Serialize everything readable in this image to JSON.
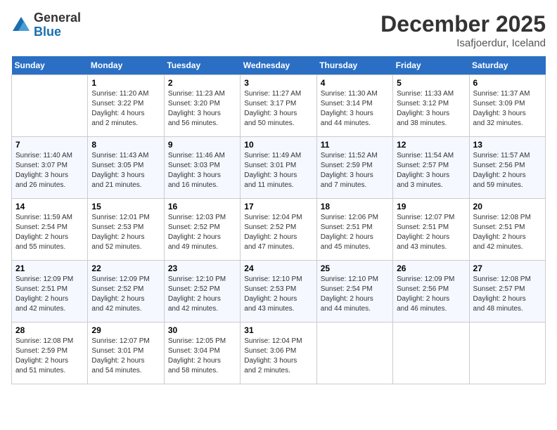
{
  "logo": {
    "general": "General",
    "blue": "Blue"
  },
  "title": "December 2025",
  "subtitle": "Isafjoerdur, Iceland",
  "days_header": [
    "Sunday",
    "Monday",
    "Tuesday",
    "Wednesday",
    "Thursday",
    "Friday",
    "Saturday"
  ],
  "weeks": [
    [
      {
        "day": "",
        "info": ""
      },
      {
        "day": "1",
        "info": "Sunrise: 11:20 AM\nSunset: 3:22 PM\nDaylight: 4 hours\nand 2 minutes."
      },
      {
        "day": "2",
        "info": "Sunrise: 11:23 AM\nSunset: 3:20 PM\nDaylight: 3 hours\nand 56 minutes."
      },
      {
        "day": "3",
        "info": "Sunrise: 11:27 AM\nSunset: 3:17 PM\nDaylight: 3 hours\nand 50 minutes."
      },
      {
        "day": "4",
        "info": "Sunrise: 11:30 AM\nSunset: 3:14 PM\nDaylight: 3 hours\nand 44 minutes."
      },
      {
        "day": "5",
        "info": "Sunrise: 11:33 AM\nSunset: 3:12 PM\nDaylight: 3 hours\nand 38 minutes."
      },
      {
        "day": "6",
        "info": "Sunrise: 11:37 AM\nSunset: 3:09 PM\nDaylight: 3 hours\nand 32 minutes."
      }
    ],
    [
      {
        "day": "7",
        "info": "Sunrise: 11:40 AM\nSunset: 3:07 PM\nDaylight: 3 hours\nand 26 minutes."
      },
      {
        "day": "8",
        "info": "Sunrise: 11:43 AM\nSunset: 3:05 PM\nDaylight: 3 hours\nand 21 minutes."
      },
      {
        "day": "9",
        "info": "Sunrise: 11:46 AM\nSunset: 3:03 PM\nDaylight: 3 hours\nand 16 minutes."
      },
      {
        "day": "10",
        "info": "Sunrise: 11:49 AM\nSunset: 3:01 PM\nDaylight: 3 hours\nand 11 minutes."
      },
      {
        "day": "11",
        "info": "Sunrise: 11:52 AM\nSunset: 2:59 PM\nDaylight: 3 hours\nand 7 minutes."
      },
      {
        "day": "12",
        "info": "Sunrise: 11:54 AM\nSunset: 2:57 PM\nDaylight: 3 hours\nand 3 minutes."
      },
      {
        "day": "13",
        "info": "Sunrise: 11:57 AM\nSunset: 2:56 PM\nDaylight: 2 hours\nand 59 minutes."
      }
    ],
    [
      {
        "day": "14",
        "info": "Sunrise: 11:59 AM\nSunset: 2:54 PM\nDaylight: 2 hours\nand 55 minutes."
      },
      {
        "day": "15",
        "info": "Sunrise: 12:01 PM\nSunset: 2:53 PM\nDaylight: 2 hours\nand 52 minutes."
      },
      {
        "day": "16",
        "info": "Sunrise: 12:03 PM\nSunset: 2:52 PM\nDaylight: 2 hours\nand 49 minutes."
      },
      {
        "day": "17",
        "info": "Sunrise: 12:04 PM\nSunset: 2:52 PM\nDaylight: 2 hours\nand 47 minutes."
      },
      {
        "day": "18",
        "info": "Sunrise: 12:06 PM\nSunset: 2:51 PM\nDaylight: 2 hours\nand 45 minutes."
      },
      {
        "day": "19",
        "info": "Sunrise: 12:07 PM\nSunset: 2:51 PM\nDaylight: 2 hours\nand 43 minutes."
      },
      {
        "day": "20",
        "info": "Sunrise: 12:08 PM\nSunset: 2:51 PM\nDaylight: 2 hours\nand 42 minutes."
      }
    ],
    [
      {
        "day": "21",
        "info": "Sunrise: 12:09 PM\nSunset: 2:51 PM\nDaylight: 2 hours\nand 42 minutes."
      },
      {
        "day": "22",
        "info": "Sunrise: 12:09 PM\nSunset: 2:52 PM\nDaylight: 2 hours\nand 42 minutes."
      },
      {
        "day": "23",
        "info": "Sunrise: 12:10 PM\nSunset: 2:52 PM\nDaylight: 2 hours\nand 42 minutes."
      },
      {
        "day": "24",
        "info": "Sunrise: 12:10 PM\nSunset: 2:53 PM\nDaylight: 2 hours\nand 43 minutes."
      },
      {
        "day": "25",
        "info": "Sunrise: 12:10 PM\nSunset: 2:54 PM\nDaylight: 2 hours\nand 44 minutes."
      },
      {
        "day": "26",
        "info": "Sunrise: 12:09 PM\nSunset: 2:56 PM\nDaylight: 2 hours\nand 46 minutes."
      },
      {
        "day": "27",
        "info": "Sunrise: 12:08 PM\nSunset: 2:57 PM\nDaylight: 2 hours\nand 48 minutes."
      }
    ],
    [
      {
        "day": "28",
        "info": "Sunrise: 12:08 PM\nSunset: 2:59 PM\nDaylight: 2 hours\nand 51 minutes."
      },
      {
        "day": "29",
        "info": "Sunrise: 12:07 PM\nSunset: 3:01 PM\nDaylight: 2 hours\nand 54 minutes."
      },
      {
        "day": "30",
        "info": "Sunrise: 12:05 PM\nSunset: 3:04 PM\nDaylight: 2 hours\nand 58 minutes."
      },
      {
        "day": "31",
        "info": "Sunrise: 12:04 PM\nSunset: 3:06 PM\nDaylight: 3 hours\nand 2 minutes."
      },
      {
        "day": "",
        "info": ""
      },
      {
        "day": "",
        "info": ""
      },
      {
        "day": "",
        "info": ""
      }
    ]
  ]
}
